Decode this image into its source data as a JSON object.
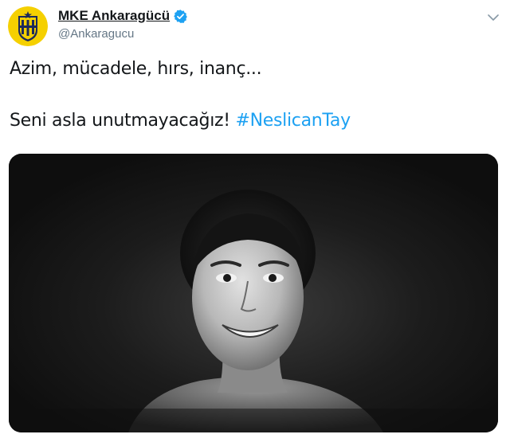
{
  "account": {
    "display_name": "MKE Ankaragücü",
    "handle": "@Ankaragucu",
    "verified": true,
    "avatar_icon": "club-crest-icon",
    "avatar_colors": {
      "yellow": "#f5d000",
      "navy": "#1c2a5a"
    }
  },
  "tweet": {
    "line1": "Azim, mücadele, hırs, inanç...",
    "line2_text": "Seni asla unutmayacağız! ",
    "hashtag": "#NeslicanTay"
  },
  "media": {
    "type": "photo",
    "description_icon": "portrait-photo",
    "background_color": "#141414"
  },
  "colors": {
    "text": "#14171a",
    "secondary": "#657786",
    "link": "#1da1f2",
    "verified": "#1da1f2"
  },
  "icons": {
    "caret": "chevron-down-icon",
    "verified": "verified-badge-icon"
  }
}
